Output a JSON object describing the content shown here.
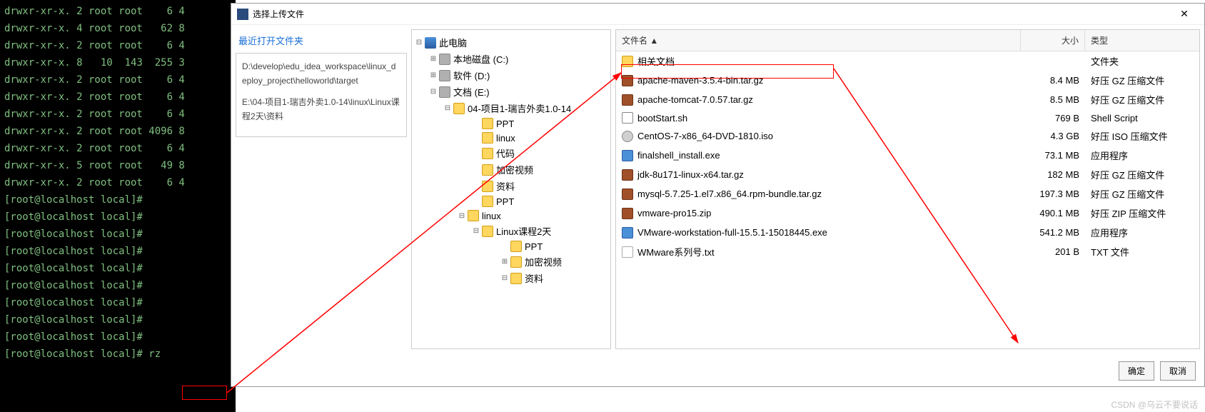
{
  "terminal": {
    "lines": [
      "drwxr-xr-x. 2 root root    6 4",
      "drwxr-xr-x. 4 root root   62 8",
      "drwxr-xr-x. 2 root root    6 4",
      "drwxr-xr-x. 8   10  143  255 3",
      "drwxr-xr-x. 2 root root    6 4",
      "drwxr-xr-x. 2 root root    6 4",
      "drwxr-xr-x. 2 root root    6 4",
      "drwxr-xr-x. 2 root root 4096 8",
      "drwxr-xr-x. 2 root root    6 4",
      "drwxr-xr-x. 5 root root   49 8",
      "drwxr-xr-x. 2 root root    6 4"
    ],
    "prompt": "[root@localhost local]#",
    "prompt_count": 9,
    "cmd": "rz"
  },
  "dialog": {
    "title": "选择上传文件",
    "close": "✕"
  },
  "left": {
    "heading": "最近打开文件夹",
    "paths": [
      "D:\\develop\\edu_idea_workspace\\linux_deploy_project\\helloworld\\target",
      "E:\\04-项目1-瑞吉外卖1.0-14\\linux\\Linux课程2天\\资料"
    ]
  },
  "tree": [
    {
      "ind": 0,
      "toggle": "⊟",
      "icon": "computer",
      "label": "此电脑"
    },
    {
      "ind": 20,
      "toggle": "⊞",
      "icon": "drive",
      "label": "本地磁盘 (C:)"
    },
    {
      "ind": 20,
      "toggle": "⊞",
      "icon": "drive",
      "label": "软件 (D:)"
    },
    {
      "ind": 20,
      "toggle": "⊟",
      "icon": "drive",
      "label": "文档 (E:)"
    },
    {
      "ind": 40,
      "toggle": "⊟",
      "icon": "folder",
      "label": "04-项目1-瑞吉外卖1.0-14"
    },
    {
      "ind": 80,
      "toggle": "",
      "icon": "folder",
      "label": "PPT"
    },
    {
      "ind": 80,
      "toggle": "",
      "icon": "folder",
      "label": "linux"
    },
    {
      "ind": 80,
      "toggle": "",
      "icon": "folder",
      "label": "代码"
    },
    {
      "ind": 80,
      "toggle": "",
      "icon": "folder",
      "label": "加密视频"
    },
    {
      "ind": 80,
      "toggle": "",
      "icon": "folder",
      "label": "资料"
    },
    {
      "ind": 80,
      "toggle": "",
      "icon": "folder",
      "label": "PPT"
    },
    {
      "ind": 60,
      "toggle": "⊟",
      "icon": "folder",
      "label": "linux"
    },
    {
      "ind": 80,
      "toggle": "⊟",
      "icon": "folder",
      "label": "Linux课程2天"
    },
    {
      "ind": 120,
      "toggle": "",
      "icon": "folder",
      "label": "PPT"
    },
    {
      "ind": 120,
      "toggle": "⊞",
      "icon": "folder",
      "label": "加密视频"
    },
    {
      "ind": 120,
      "toggle": "⊟",
      "icon": "folder",
      "label": "资料"
    }
  ],
  "files": {
    "header": {
      "name": "文件名 ▲",
      "size": "大小",
      "type": "类型"
    },
    "rows": [
      {
        "icon": "folder",
        "name": "相关文档",
        "size": "",
        "type": "文件夹"
      },
      {
        "icon": "archive",
        "name": "apache-maven-3.5.4-bin.tar.gz",
        "size": "8.4 MB",
        "type": "好压 GZ 压缩文件"
      },
      {
        "icon": "archive",
        "name": "apache-tomcat-7.0.57.tar.gz",
        "size": "8.5 MB",
        "type": "好压 GZ 压缩文件"
      },
      {
        "icon": "script",
        "name": "bootStart.sh",
        "size": "769 B",
        "type": "Shell Script"
      },
      {
        "icon": "iso",
        "name": "CentOS-7-x86_64-DVD-1810.iso",
        "size": "4.3 GB",
        "type": "好压 ISO 压缩文件"
      },
      {
        "icon": "exe",
        "name": "finalshell_install.exe",
        "size": "73.1 MB",
        "type": "应用程序"
      },
      {
        "icon": "archive",
        "name": "jdk-8u171-linux-x64.tar.gz",
        "size": "182 MB",
        "type": "好压 GZ 压缩文件"
      },
      {
        "icon": "archive",
        "name": "mysql-5.7.25-1.el7.x86_64.rpm-bundle.tar.gz",
        "size": "197.3 MB",
        "type": "好压 GZ 压缩文件"
      },
      {
        "icon": "archive",
        "name": "vmware-pro15.zip",
        "size": "490.1 MB",
        "type": "好压 ZIP 压缩文件"
      },
      {
        "icon": "exe",
        "name": "VMware-workstation-full-15.5.1-15018445.exe",
        "size": "541.2 MB",
        "type": "应用程序"
      },
      {
        "icon": "txt",
        "name": "WMware系列号.txt",
        "size": "201 B",
        "type": "TXT 文件"
      }
    ]
  },
  "buttons": {
    "ok": "确定",
    "cancel": "取消"
  },
  "watermark": "CSDN @乌云不要说话"
}
